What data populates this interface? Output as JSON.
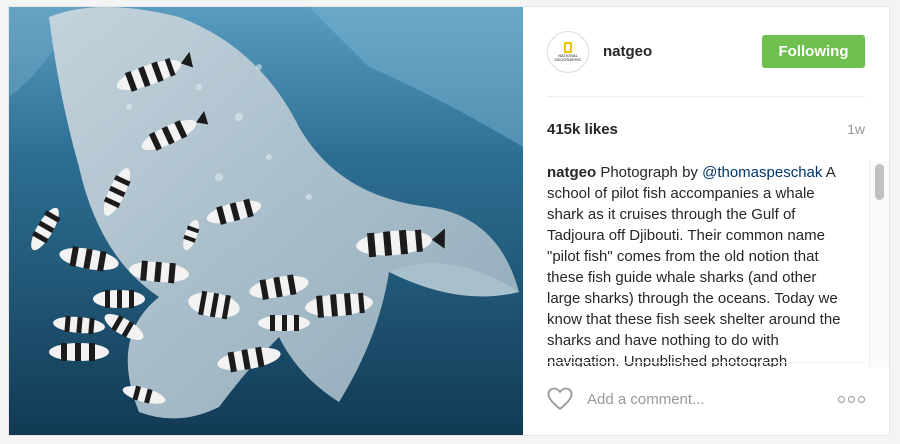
{
  "profile": {
    "username": "natgeo",
    "avatar_label": "NATIONAL GEOGRAPHIC",
    "follow_label": "Following"
  },
  "post": {
    "likes": "415k likes",
    "age": "1w",
    "caption_user": "natgeo",
    "caption_text_1": " Photograph by ",
    "mention": "@thomaspeschak",
    "caption_text_2": " A school of pilot fish accompanies a whale shark as it cruises through the Gulf of Tadjoura off Djibouti. Their common name \"pilot fish\" comes from the old notion that these fish guide whale sharks (and other large sharks) through the oceans. Today we know that these fish seek shelter around the sharks and have nothing to do with navigation. Unpublished photograph"
  },
  "comment": {
    "placeholder": "Add a comment..."
  },
  "icons": {
    "like": "heart-icon",
    "options": "more-options-icon"
  },
  "colors": {
    "follow_button": "#70c050",
    "mention": "#003569",
    "muted": "#999999"
  }
}
